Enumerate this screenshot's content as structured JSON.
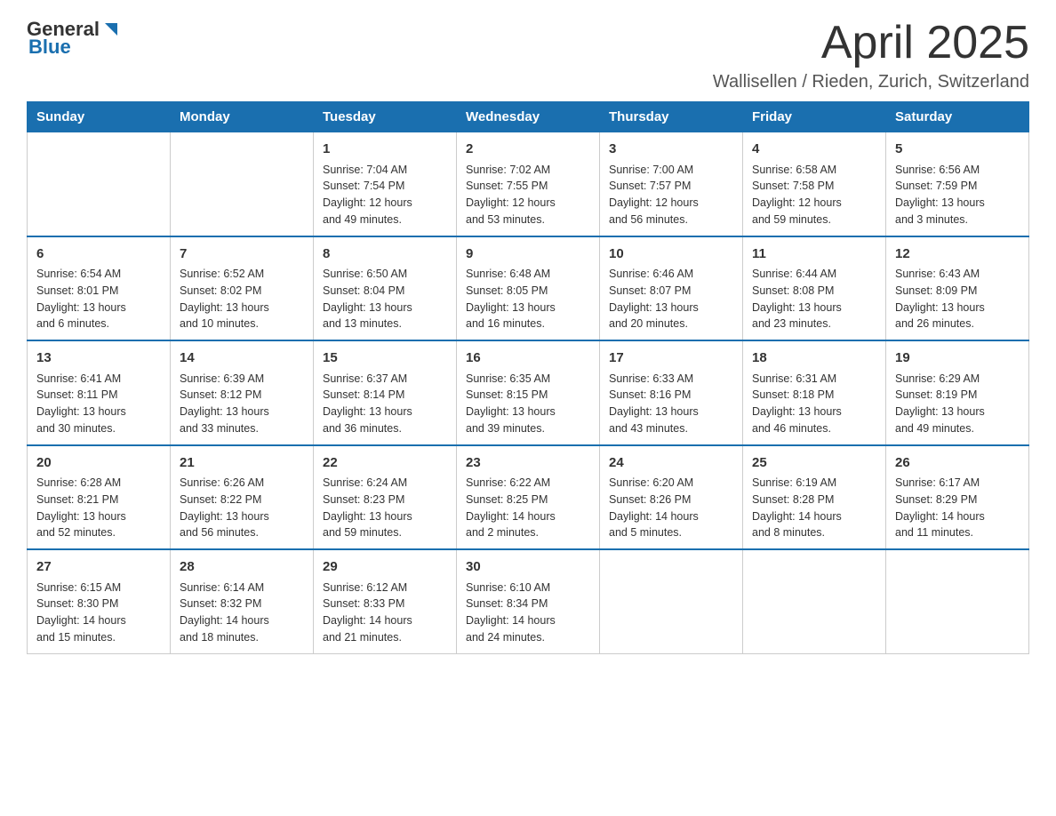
{
  "header": {
    "logo_general": "General",
    "logo_blue": "Blue",
    "month_title": "April 2025",
    "location": "Wallisellen / Rieden, Zurich, Switzerland"
  },
  "columns": [
    "Sunday",
    "Monday",
    "Tuesday",
    "Wednesday",
    "Thursday",
    "Friday",
    "Saturday"
  ],
  "weeks": [
    [
      {
        "day": "",
        "info": ""
      },
      {
        "day": "",
        "info": ""
      },
      {
        "day": "1",
        "info": "Sunrise: 7:04 AM\nSunset: 7:54 PM\nDaylight: 12 hours\nand 49 minutes."
      },
      {
        "day": "2",
        "info": "Sunrise: 7:02 AM\nSunset: 7:55 PM\nDaylight: 12 hours\nand 53 minutes."
      },
      {
        "day": "3",
        "info": "Sunrise: 7:00 AM\nSunset: 7:57 PM\nDaylight: 12 hours\nand 56 minutes."
      },
      {
        "day": "4",
        "info": "Sunrise: 6:58 AM\nSunset: 7:58 PM\nDaylight: 12 hours\nand 59 minutes."
      },
      {
        "day": "5",
        "info": "Sunrise: 6:56 AM\nSunset: 7:59 PM\nDaylight: 13 hours\nand 3 minutes."
      }
    ],
    [
      {
        "day": "6",
        "info": "Sunrise: 6:54 AM\nSunset: 8:01 PM\nDaylight: 13 hours\nand 6 minutes."
      },
      {
        "day": "7",
        "info": "Sunrise: 6:52 AM\nSunset: 8:02 PM\nDaylight: 13 hours\nand 10 minutes."
      },
      {
        "day": "8",
        "info": "Sunrise: 6:50 AM\nSunset: 8:04 PM\nDaylight: 13 hours\nand 13 minutes."
      },
      {
        "day": "9",
        "info": "Sunrise: 6:48 AM\nSunset: 8:05 PM\nDaylight: 13 hours\nand 16 minutes."
      },
      {
        "day": "10",
        "info": "Sunrise: 6:46 AM\nSunset: 8:07 PM\nDaylight: 13 hours\nand 20 minutes."
      },
      {
        "day": "11",
        "info": "Sunrise: 6:44 AM\nSunset: 8:08 PM\nDaylight: 13 hours\nand 23 minutes."
      },
      {
        "day": "12",
        "info": "Sunrise: 6:43 AM\nSunset: 8:09 PM\nDaylight: 13 hours\nand 26 minutes."
      }
    ],
    [
      {
        "day": "13",
        "info": "Sunrise: 6:41 AM\nSunset: 8:11 PM\nDaylight: 13 hours\nand 30 minutes."
      },
      {
        "day": "14",
        "info": "Sunrise: 6:39 AM\nSunset: 8:12 PM\nDaylight: 13 hours\nand 33 minutes."
      },
      {
        "day": "15",
        "info": "Sunrise: 6:37 AM\nSunset: 8:14 PM\nDaylight: 13 hours\nand 36 minutes."
      },
      {
        "day": "16",
        "info": "Sunrise: 6:35 AM\nSunset: 8:15 PM\nDaylight: 13 hours\nand 39 minutes."
      },
      {
        "day": "17",
        "info": "Sunrise: 6:33 AM\nSunset: 8:16 PM\nDaylight: 13 hours\nand 43 minutes."
      },
      {
        "day": "18",
        "info": "Sunrise: 6:31 AM\nSunset: 8:18 PM\nDaylight: 13 hours\nand 46 minutes."
      },
      {
        "day": "19",
        "info": "Sunrise: 6:29 AM\nSunset: 8:19 PM\nDaylight: 13 hours\nand 49 minutes."
      }
    ],
    [
      {
        "day": "20",
        "info": "Sunrise: 6:28 AM\nSunset: 8:21 PM\nDaylight: 13 hours\nand 52 minutes."
      },
      {
        "day": "21",
        "info": "Sunrise: 6:26 AM\nSunset: 8:22 PM\nDaylight: 13 hours\nand 56 minutes."
      },
      {
        "day": "22",
        "info": "Sunrise: 6:24 AM\nSunset: 8:23 PM\nDaylight: 13 hours\nand 59 minutes."
      },
      {
        "day": "23",
        "info": "Sunrise: 6:22 AM\nSunset: 8:25 PM\nDaylight: 14 hours\nand 2 minutes."
      },
      {
        "day": "24",
        "info": "Sunrise: 6:20 AM\nSunset: 8:26 PM\nDaylight: 14 hours\nand 5 minutes."
      },
      {
        "day": "25",
        "info": "Sunrise: 6:19 AM\nSunset: 8:28 PM\nDaylight: 14 hours\nand 8 minutes."
      },
      {
        "day": "26",
        "info": "Sunrise: 6:17 AM\nSunset: 8:29 PM\nDaylight: 14 hours\nand 11 minutes."
      }
    ],
    [
      {
        "day": "27",
        "info": "Sunrise: 6:15 AM\nSunset: 8:30 PM\nDaylight: 14 hours\nand 15 minutes."
      },
      {
        "day": "28",
        "info": "Sunrise: 6:14 AM\nSunset: 8:32 PM\nDaylight: 14 hours\nand 18 minutes."
      },
      {
        "day": "29",
        "info": "Sunrise: 6:12 AM\nSunset: 8:33 PM\nDaylight: 14 hours\nand 21 minutes."
      },
      {
        "day": "30",
        "info": "Sunrise: 6:10 AM\nSunset: 8:34 PM\nDaylight: 14 hours\nand 24 minutes."
      },
      {
        "day": "",
        "info": ""
      },
      {
        "day": "",
        "info": ""
      },
      {
        "day": "",
        "info": ""
      }
    ]
  ]
}
